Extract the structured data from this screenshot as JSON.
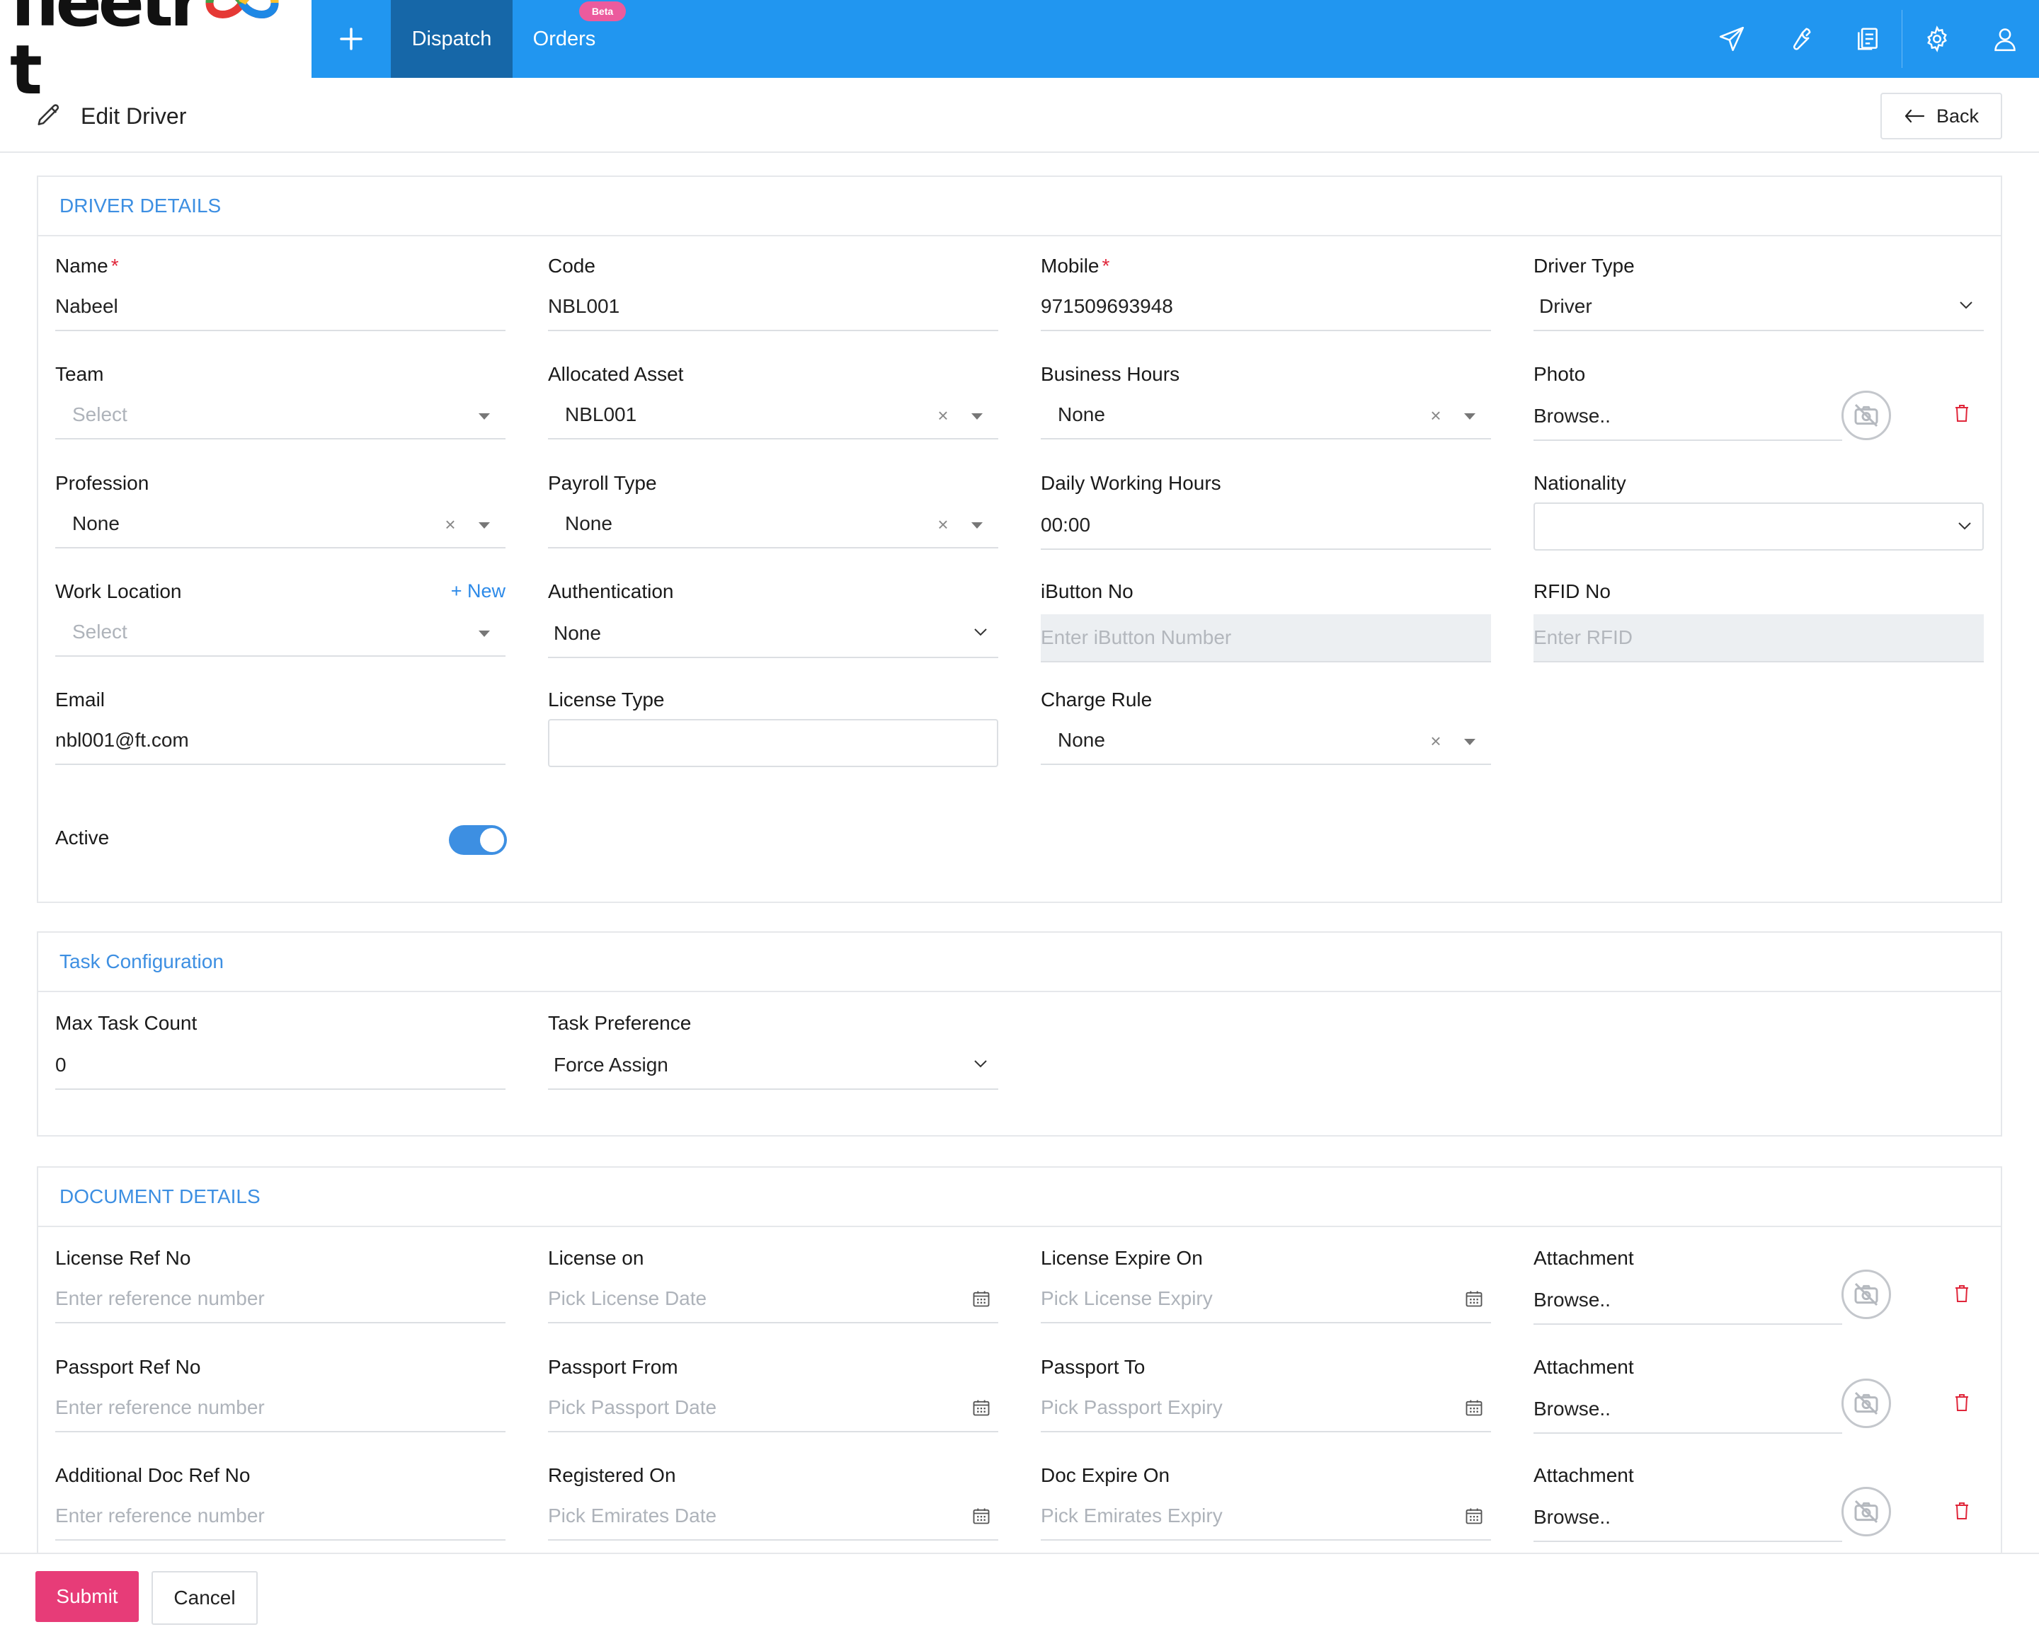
{
  "nav": {
    "logo_left": "fleetr",
    "logo_right": "t",
    "items": [
      "Dispatch",
      "Orders"
    ],
    "beta": "Beta"
  },
  "header": {
    "title": "Edit Driver",
    "back": "Back"
  },
  "driver": {
    "section_title": "DRIVER DETAILS",
    "name": {
      "label": "Name",
      "value": "Nabeel"
    },
    "code": {
      "label": "Code",
      "value": "NBL001"
    },
    "mobile": {
      "label": "Mobile",
      "value": "971509693948"
    },
    "driver_type": {
      "label": "Driver Type",
      "value": "Driver"
    },
    "team": {
      "label": "Team",
      "placeholder": "Select"
    },
    "allocated_asset": {
      "label": "Allocated Asset",
      "value": "NBL001"
    },
    "business_hours": {
      "label": "Business Hours",
      "value": "None"
    },
    "photo": {
      "label": "Photo",
      "value": "Browse.."
    },
    "profession": {
      "label": "Profession",
      "value": "None"
    },
    "payroll_type": {
      "label": "Payroll Type",
      "value": "None"
    },
    "daily_hours": {
      "label": "Daily Working Hours",
      "value": "00:00"
    },
    "nationality": {
      "label": "Nationality",
      "value": ""
    },
    "work_location": {
      "label": "Work Location",
      "placeholder": "Select",
      "new_link": "+ New"
    },
    "authentication": {
      "label": "Authentication",
      "value": "None"
    },
    "ibutton": {
      "label": "iButton No",
      "placeholder": "Enter iButton Number"
    },
    "rfid": {
      "label": "RFID No",
      "placeholder": "Enter RFID"
    },
    "email": {
      "label": "Email",
      "value": "nbl001@ft.com"
    },
    "license_type": {
      "label": "License Type",
      "value": ""
    },
    "charge_rule": {
      "label": "Charge Rule",
      "value": "None"
    },
    "active": {
      "label": "Active",
      "on": true
    },
    "required_mark": "*",
    "clear_symbol": "×"
  },
  "task": {
    "section_title": "Task Configuration",
    "max_task": {
      "label": "Max Task Count",
      "value": "0"
    },
    "preference": {
      "label": "Task Preference",
      "value": "Force Assign"
    }
  },
  "documents": {
    "section_title": "DOCUMENT DETAILS",
    "rows": [
      {
        "ref_label": "License Ref No",
        "ref_placeholder": "Enter reference number",
        "from_label": "License on",
        "from_placeholder": "Pick License Date",
        "to_label": "License Expire On",
        "to_placeholder": "Pick License Expiry",
        "attach_label": "Attachment",
        "attach_value": "Browse.."
      },
      {
        "ref_label": "Passport Ref No",
        "ref_placeholder": "Enter reference number",
        "from_label": "Passport From",
        "from_placeholder": "Pick Passport Date",
        "to_label": "Passport To",
        "to_placeholder": "Pick Passport Expiry",
        "attach_label": "Attachment",
        "attach_value": "Browse.."
      },
      {
        "ref_label": "Additional Doc Ref No",
        "ref_placeholder": "Enter reference number",
        "from_label": "Registered On",
        "from_placeholder": "Pick Emirates Date",
        "to_label": "Doc Expire On",
        "to_placeholder": "Pick Emirates Expiry",
        "attach_label": "Attachment",
        "attach_value": "Browse.."
      }
    ]
  },
  "footer": {
    "submit": "Submit",
    "cancel": "Cancel"
  },
  "colors": {
    "nav_bg": "#2196f0",
    "nav_active": "#1667a8",
    "accent": "#3d8fe2",
    "submit": "#e73c78",
    "beta": "#ec5b9d",
    "danger": "#e0263a"
  },
  "icons": [
    "plus-icon",
    "send-icon",
    "wrench-icon",
    "document-icon",
    "gear-icon",
    "user-icon",
    "pencil-icon",
    "back-arrow-icon",
    "chevron-down-icon",
    "camera-off-icon",
    "trash-icon",
    "calendar-icon"
  ]
}
